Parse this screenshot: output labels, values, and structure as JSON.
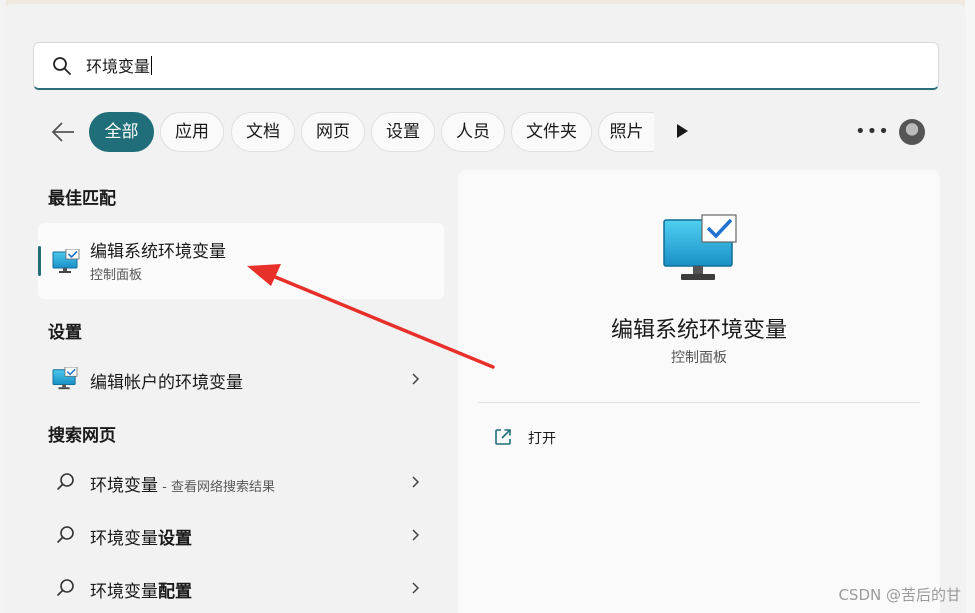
{
  "search": {
    "value": "环境变量"
  },
  "filters": [
    "全部",
    "应用",
    "文档",
    "网页",
    "设置",
    "人员",
    "文件夹",
    "照片"
  ],
  "sections": {
    "best_match": "最佳匹配",
    "settings": "设置",
    "web": "搜索网页"
  },
  "best_match": {
    "title": "编辑系统环境变量",
    "subtitle": "控制面板"
  },
  "settings_items": [
    {
      "label": "编辑帐户的环境变量"
    }
  ],
  "web_items": [
    {
      "label": "环境变量",
      "suffix": " - 查看网络搜索结果"
    },
    {
      "label": "环境变量",
      "bold": "设置"
    },
    {
      "label": "环境变量",
      "bold": "配置"
    }
  ],
  "preview": {
    "title": "编辑系统环境变量",
    "subtitle": "控制面板",
    "open_label": "打开"
  },
  "watermark": "CSDN @苦后的甘",
  "colors": {
    "accent": "#1f6e79",
    "annotation_arrow": "#e8302a"
  },
  "icons": {
    "search": "search-icon",
    "back": "arrow-left-icon",
    "more": "play-triangle-icon",
    "options": "more-dots-icon",
    "monitor": "monitor-check-icon",
    "chevron": "chevron-right-icon",
    "open": "open-external-icon"
  }
}
